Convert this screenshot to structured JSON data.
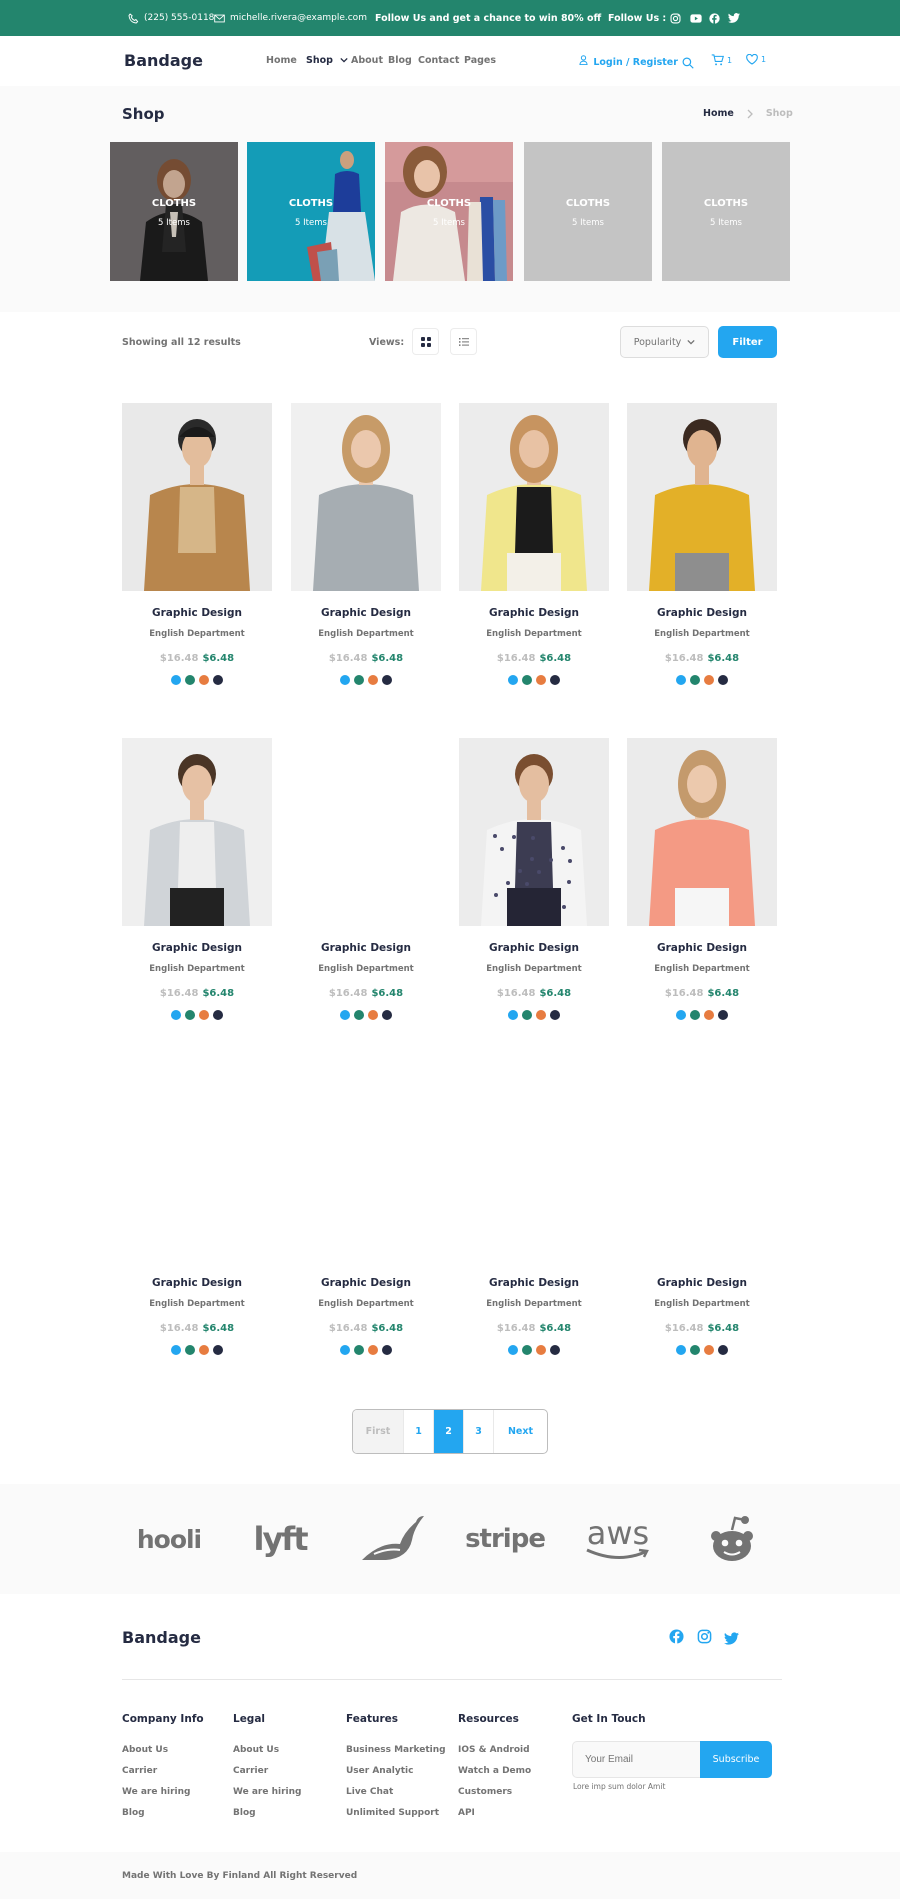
{
  "topbar": {
    "phone": "(225) 555-0118",
    "email": "michelle.rivera@example.com",
    "promo": "Follow Us  and get a chance to win 80% off",
    "follow_label": "Follow Us  :",
    "bg_color": "#23856D"
  },
  "nav": {
    "brand": "Bandage",
    "links": [
      "Home",
      "Shop",
      "About",
      "Blog",
      "Contact",
      "Pages"
    ],
    "login": "Login / Register",
    "cart_count": "1",
    "wishlist_count": "1",
    "accent_color": "#23A6F0"
  },
  "shop": {
    "title": "Shop",
    "breadcrumb": [
      "Home",
      "Shop"
    ],
    "categories": [
      {
        "label": "CLOTHS",
        "count": "5 Items"
      },
      {
        "label": "CLOTHS",
        "count": "5 Items"
      },
      {
        "label": "CLOTHS",
        "count": "5 Items"
      },
      {
        "label": "CLOTHS",
        "count": "5 Items"
      },
      {
        "label": "CLOTHS",
        "count": "5 Items"
      }
    ]
  },
  "filter": {
    "results": "Showing all 12 results",
    "views_label": "Views:",
    "sort": "Popularity",
    "button": "Filter"
  },
  "product": {
    "title": "Graphic Design",
    "department": "English Department",
    "old_price": "$16.48",
    "new_price": "$6.48",
    "swatches": [
      "#23A6F0",
      "#23856D",
      "#E77C40",
      "#252B42"
    ]
  },
  "pagination": [
    "First",
    "1",
    "2",
    "3",
    "Next"
  ],
  "pagination_active": "2",
  "brands": [
    "hooli",
    "lyft",
    "stripe",
    "aws"
  ],
  "footer": {
    "brand": "Bandage",
    "columns": [
      {
        "title": "Company Info",
        "links": [
          "About Us",
          "Carrier",
          "We are hiring",
          "Blog"
        ]
      },
      {
        "title": "Legal",
        "links": [
          "About Us",
          "Carrier",
          "We are hiring",
          "Blog"
        ]
      },
      {
        "title": "Features",
        "links": [
          "Business Marketing",
          "User Analytic",
          "Live Chat",
          "Unlimited Support"
        ]
      },
      {
        "title": "Resources",
        "links": [
          "IOS & Android",
          "Watch a Demo",
          "Customers",
          "API"
        ]
      }
    ],
    "contact_title": "Get In Touch",
    "email_placeholder": "Your Email",
    "subscribe": "Subscribe",
    "note": "Lore imp sum dolor Amit",
    "copyright": "Made With Love By Finland All Right Reserved"
  }
}
